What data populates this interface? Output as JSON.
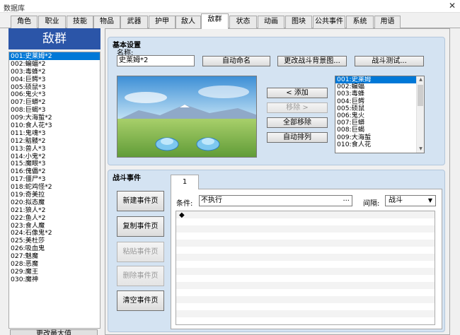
{
  "window": {
    "title": "数据库",
    "close_glyph": "✕"
  },
  "tabs": [
    "角色",
    "职业",
    "技能",
    "物品",
    "武器",
    "护甲",
    "敌人",
    "敌群",
    "状态",
    "动画",
    "图块",
    "公共事件",
    "系统",
    "用语"
  ],
  "active_tab": "敌群",
  "left": {
    "header": "敌群",
    "items": [
      "001:史莱姆*2",
      "002:蝙蝠*2",
      "003:毒蜂*2",
      "004:巨鳄*3",
      "005:硕鼠*3",
      "006:鬼火*3",
      "007:巨蟒*2",
      "008:巨蝎*3",
      "009:大海蜇*2",
      "010:食人花*3",
      "011:鬼魂*3",
      "012:骷髅*2",
      "013:兽人*3",
      "014:小鬼*2",
      "015:魔眼*3",
      "016:傀儡*2",
      "017:僵尸*3",
      "018:蛇鸡怪*2",
      "019:奇美拉",
      "020:拟态魔",
      "021:狼人*2",
      "022:鱼人*2",
      "023:食人魔",
      "024:石像鬼*2",
      "025:美杜莎",
      "026:吸血鬼",
      "027:魅魔",
      "028:恶魔",
      "029:魔王",
      "030:魔神"
    ],
    "selected_index": 0,
    "change_max_button": "更改最大值"
  },
  "basic": {
    "title": "基本设置",
    "name_label": "名称:",
    "name_value": "史莱姆*2",
    "auto_name_button": "自动命名",
    "change_bg_button": "更改战斗背景图...",
    "battle_test_button": "战斗测试...",
    "add_button": "< 添加",
    "remove_button": "移除 >",
    "remove_all_button": "全部移除",
    "auto_arrange_button": "自动排列",
    "troop_members": [
      "001:史莱姆",
      "002:蝙蝠",
      "003:毒蜂",
      "004:巨鳄",
      "005:硕鼠",
      "006:鬼火",
      "007:巨蟒",
      "008:巨蝎",
      "009:大海蜇",
      "010:食人花"
    ],
    "troop_selected_index": 0
  },
  "battle": {
    "title": "战斗事件",
    "new_page_button": "新建事件页",
    "copy_page_button": "复制事件页",
    "paste_page_button": "粘贴事件页",
    "delete_page_button": "删除事件页",
    "clear_page_button": "清空事件页",
    "page_tab": "1",
    "condition_label": "条件:",
    "condition_value": "不执行",
    "condition_ellipsis": "...",
    "span_label": "间隔:",
    "span_value": "战斗",
    "command_marker": "◆"
  },
  "colors": {
    "accent": "#2b55a8",
    "selection": "#0078d7",
    "group_bg": "#d4e3f2"
  }
}
